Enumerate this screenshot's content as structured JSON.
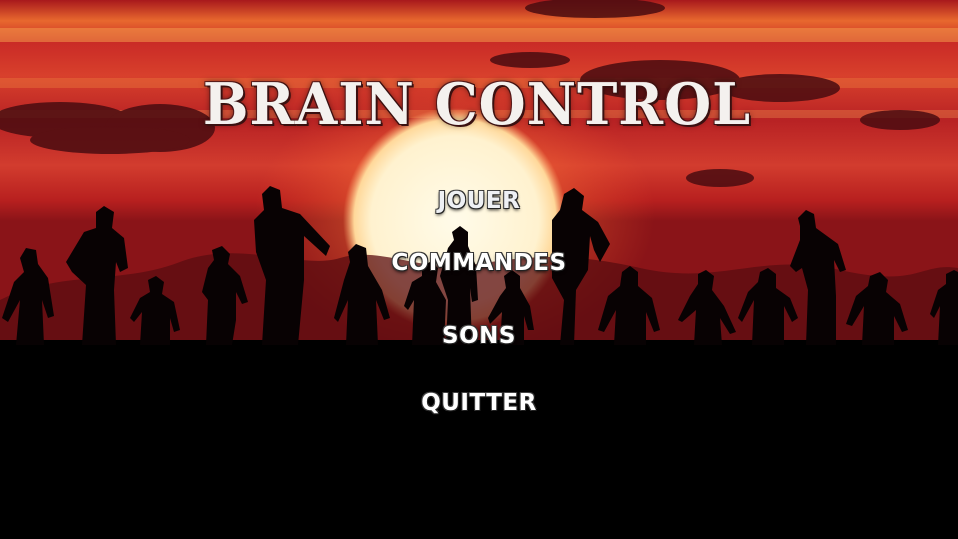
{
  "game": {
    "title": "BRAIN CONTROL"
  },
  "menu": {
    "play_label": "JOUER",
    "controls_label": "COMMANDES",
    "sounds_label": "SONS",
    "quit_label": "QUITTER"
  },
  "colors": {
    "sky_top": "#b81f22",
    "sky_band": "#f27a3a",
    "sun": "#fff4d8",
    "ground": "#000000"
  }
}
